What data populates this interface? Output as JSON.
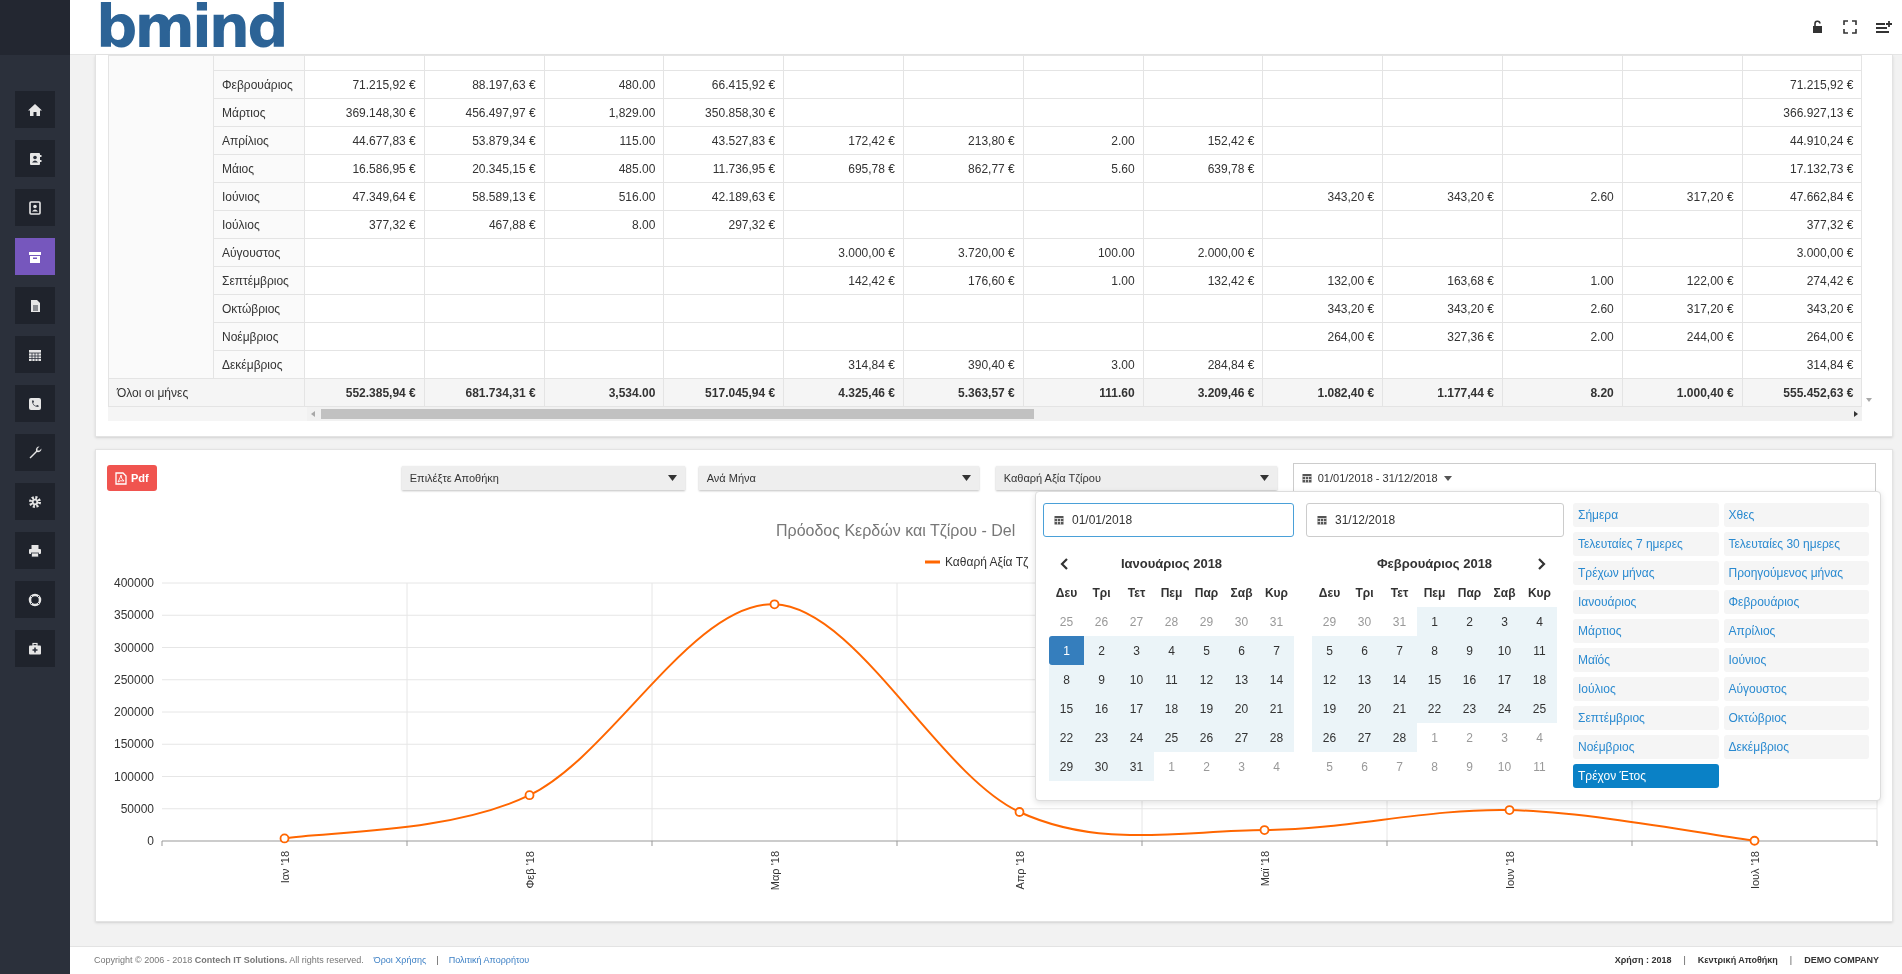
{
  "header": {
    "logo": "bmind"
  },
  "sidebar": {
    "items": [
      {
        "selected": false
      },
      {
        "selected": false
      },
      {
        "selected": false
      },
      {
        "selected": true
      },
      {
        "selected": false
      },
      {
        "selected": false
      },
      {
        "selected": false
      },
      {
        "selected": false
      },
      {
        "selected": false
      },
      {
        "selected": false
      },
      {
        "selected": false
      },
      {
        "selected": false
      }
    ]
  },
  "table": {
    "rows": [
      {
        "month": "Φεβρουάριος",
        "cells": [
          {
            "kind": "value",
            "text": "71.215,92 €"
          },
          {
            "kind": "value",
            "text": "88.197,63 €"
          },
          {
            "kind": "value",
            "text": "480.00"
          },
          {
            "kind": "value",
            "text": "66.415,92 €"
          },
          {
            "kind": "empty"
          },
          {
            "kind": "empty"
          },
          {
            "kind": "empty"
          },
          {
            "kind": "empty"
          },
          {
            "kind": "empty"
          },
          {
            "kind": "empty"
          },
          {
            "kind": "empty"
          },
          {
            "kind": "empty"
          },
          {
            "kind": "value",
            "text": "71.215,92 €"
          }
        ]
      },
      {
        "month": "Μάρτιος",
        "cells": [
          {
            "kind": "value",
            "text": "369.148,30 €"
          },
          {
            "kind": "value",
            "text": "456.497,97 €"
          },
          {
            "kind": "value",
            "text": "1,829.00"
          },
          {
            "kind": "value",
            "text": "350.858,30 €"
          },
          {
            "kind": "empty"
          },
          {
            "kind": "empty"
          },
          {
            "kind": "empty"
          },
          {
            "kind": "empty"
          },
          {
            "kind": "empty"
          },
          {
            "kind": "empty"
          },
          {
            "kind": "empty"
          },
          {
            "kind": "empty"
          },
          {
            "kind": "value",
            "text": "366.927,13 €"
          }
        ]
      },
      {
        "month": "Απρίλιος",
        "cells": [
          {
            "kind": "value",
            "text": "44.677,83 €"
          },
          {
            "kind": "value",
            "text": "53.879,34 €"
          },
          {
            "kind": "value",
            "text": "115.00"
          },
          {
            "kind": "value",
            "text": "43.527,83 €"
          },
          {
            "kind": "value",
            "text": "172,42 €"
          },
          {
            "kind": "value",
            "text": "213,80 €"
          },
          {
            "kind": "value",
            "text": "2.00"
          },
          {
            "kind": "value",
            "text": "152,42 €"
          },
          {
            "kind": "empty"
          },
          {
            "kind": "empty"
          },
          {
            "kind": "empty"
          },
          {
            "kind": "empty"
          },
          {
            "kind": "value",
            "text": "44.910,24 €"
          }
        ]
      },
      {
        "month": "Μάιος",
        "cells": [
          {
            "kind": "value",
            "text": "16.586,95 €"
          },
          {
            "kind": "value",
            "text": "20.345,15 €"
          },
          {
            "kind": "value",
            "text": "485.00"
          },
          {
            "kind": "value",
            "text": "11.736,95 €"
          },
          {
            "kind": "value",
            "text": "695,78 €"
          },
          {
            "kind": "value",
            "text": "862,77 €"
          },
          {
            "kind": "value",
            "text": "5.60"
          },
          {
            "kind": "value",
            "text": "639,78 €"
          },
          {
            "kind": "empty"
          },
          {
            "kind": "empty"
          },
          {
            "kind": "empty"
          },
          {
            "kind": "empty"
          },
          {
            "kind": "value",
            "text": "17.132,73 €"
          }
        ]
      },
      {
        "month": "Ιούνιος",
        "cells": [
          {
            "kind": "value",
            "text": "47.349,64 €"
          },
          {
            "kind": "value",
            "text": "58.589,13 €"
          },
          {
            "kind": "value",
            "text": "516.00"
          },
          {
            "kind": "value",
            "text": "42.189,63 €"
          },
          {
            "kind": "empty"
          },
          {
            "kind": "empty"
          },
          {
            "kind": "empty"
          },
          {
            "kind": "empty"
          },
          {
            "kind": "value",
            "text": "343,20 €"
          },
          {
            "kind": "value",
            "text": "343,20 €"
          },
          {
            "kind": "value",
            "text": "2.60"
          },
          {
            "kind": "value",
            "text": "317,20 €"
          },
          {
            "kind": "value",
            "text": "47.662,84 €"
          }
        ]
      },
      {
        "month": "Ιούλιος",
        "cells": [
          {
            "kind": "value",
            "text": "377,32 €"
          },
          {
            "kind": "value",
            "text": "467,88 €"
          },
          {
            "kind": "value",
            "text": "8.00"
          },
          {
            "kind": "value",
            "text": "297,32 €"
          },
          {
            "kind": "empty"
          },
          {
            "kind": "empty"
          },
          {
            "kind": "empty"
          },
          {
            "kind": "empty"
          },
          {
            "kind": "empty"
          },
          {
            "kind": "empty"
          },
          {
            "kind": "empty"
          },
          {
            "kind": "empty"
          },
          {
            "kind": "value",
            "text": "377,32 €"
          }
        ]
      },
      {
        "month": "Αύγουστος",
        "cells": [
          {
            "kind": "empty"
          },
          {
            "kind": "empty"
          },
          {
            "kind": "empty"
          },
          {
            "kind": "empty"
          },
          {
            "kind": "value",
            "text": "3.000,00 €"
          },
          {
            "kind": "value",
            "text": "3.720,00 €"
          },
          {
            "kind": "value",
            "text": "100.00"
          },
          {
            "kind": "value",
            "text": "2.000,00 €"
          },
          {
            "kind": "empty"
          },
          {
            "kind": "empty"
          },
          {
            "kind": "empty"
          },
          {
            "kind": "empty"
          },
          {
            "kind": "value",
            "text": "3.000,00 €"
          }
        ]
      },
      {
        "month": "Σεπτέμβριος",
        "cells": [
          {
            "kind": "empty"
          },
          {
            "kind": "empty"
          },
          {
            "kind": "empty"
          },
          {
            "kind": "empty"
          },
          {
            "kind": "value",
            "text": "142,42 €"
          },
          {
            "kind": "value",
            "text": "176,60 €"
          },
          {
            "kind": "value",
            "text": "1.00"
          },
          {
            "kind": "value",
            "text": "132,42 €"
          },
          {
            "kind": "value",
            "text": "132,00 €"
          },
          {
            "kind": "value",
            "text": "163,68 €"
          },
          {
            "kind": "value",
            "text": "1.00"
          },
          {
            "kind": "value",
            "text": "122,00 €"
          },
          {
            "kind": "value",
            "text": "274,42 €"
          }
        ]
      },
      {
        "month": "Οκτώβριος",
        "cells": [
          {
            "kind": "empty"
          },
          {
            "kind": "empty"
          },
          {
            "kind": "empty"
          },
          {
            "kind": "empty"
          },
          {
            "kind": "empty"
          },
          {
            "kind": "empty"
          },
          {
            "kind": "empty"
          },
          {
            "kind": "empty"
          },
          {
            "kind": "value",
            "text": "343,20 €"
          },
          {
            "kind": "value",
            "text": "343,20 €"
          },
          {
            "kind": "value",
            "text": "2.60"
          },
          {
            "kind": "value",
            "text": "317,20 €"
          },
          {
            "kind": "value",
            "text": "343,20 €"
          }
        ]
      },
      {
        "month": "Νοέμβριος",
        "cells": [
          {
            "kind": "empty"
          },
          {
            "kind": "empty"
          },
          {
            "kind": "empty"
          },
          {
            "kind": "empty"
          },
          {
            "kind": "empty"
          },
          {
            "kind": "empty"
          },
          {
            "kind": "empty"
          },
          {
            "kind": "empty"
          },
          {
            "kind": "value",
            "text": "264,00 €"
          },
          {
            "kind": "value",
            "text": "327,36 €"
          },
          {
            "kind": "value",
            "text": "2.00"
          },
          {
            "kind": "value",
            "text": "244,00 €"
          },
          {
            "kind": "value",
            "text": "264,00 €"
          }
        ]
      },
      {
        "month": "Δεκέμβριος",
        "cells": [
          {
            "kind": "empty"
          },
          {
            "kind": "empty"
          },
          {
            "kind": "empty"
          },
          {
            "kind": "empty"
          },
          {
            "kind": "value",
            "text": "314,84 €"
          },
          {
            "kind": "value",
            "text": "390,40 €"
          },
          {
            "kind": "value",
            "text": "3.00"
          },
          {
            "kind": "value",
            "text": "284,84 €"
          },
          {
            "kind": "empty"
          },
          {
            "kind": "empty"
          },
          {
            "kind": "empty"
          },
          {
            "kind": "empty"
          },
          {
            "kind": "value",
            "text": "314,84 €"
          }
        ]
      }
    ],
    "total": {
      "label": "Όλοι οι μήνες",
      "values": [
        "552.385,94 €",
        "681.734,31 €",
        "3,534.00",
        "517.045,94 €",
        "4.325,46 €",
        "5.363,57 €",
        "111.60",
        "3.209,46 €",
        "1.082,40 €",
        "1.177,44 €",
        "8.20",
        "1.000,40 €",
        "555.452,63 €"
      ]
    }
  },
  "chart_panel": {
    "pdf_button": "Pdf",
    "filters": [
      {
        "value": "Επιλέξτε Αποθήκη"
      },
      {
        "value": "Ανά Μήνα"
      },
      {
        "value": "Καθαρή Αξία Τζίρου"
      }
    ],
    "date_range": "01/01/2018 - 31/12/2018",
    "chart_data": {
      "type": "line",
      "title": "Πρόοδος Κερδών και Τζίρου - Del",
      "categories": [
        "Ιαν '18",
        "Φεβ '18",
        "Μαρ '18",
        "Απρ '18",
        "Μαϊ '18",
        "Ιουν '18",
        "Ιουλ '18"
      ],
      "series": [
        {
          "name": "Καθαρή Αξία Τζ",
          "color": "#ff6600",
          "marker": true,
          "values": [
            4000,
            71000,
            367000,
            45000,
            17000,
            48000,
            400
          ]
        }
      ],
      "ylim": [
        0,
        400000
      ],
      "yticks": [
        0,
        50000,
        100000,
        150000,
        200000,
        250000,
        300000,
        350000,
        400000
      ],
      "grid": true
    },
    "date_picker": {
      "start_input": "01/01/2018",
      "end_input": "31/12/2018",
      "calendars": [
        {
          "title": "Ιανουάριος 2018",
          "weekdays": [
            "Δευ",
            "Τρι",
            "Τετ",
            "Πεμ",
            "Παρ",
            "Σαβ",
            "Κυρ"
          ],
          "weeks": [
            [
              {
                "day": "25",
                "kind": "off"
              },
              {
                "day": "26",
                "kind": "off"
              },
              {
                "day": "27",
                "kind": "off"
              },
              {
                "day": "28",
                "kind": "off"
              },
              {
                "day": "29",
                "kind": "off"
              },
              {
                "day": "30",
                "kind": "off"
              },
              {
                "day": "31",
                "kind": "off"
              }
            ],
            [
              {
                "day": "1",
                "kind": "start"
              },
              {
                "day": "2",
                "kind": "in_range"
              },
              {
                "day": "3",
                "kind": "in_range"
              },
              {
                "day": "4",
                "kind": "in_range"
              },
              {
                "day": "5",
                "kind": "in_range"
              },
              {
                "day": "6",
                "kind": "in_range"
              },
              {
                "day": "7",
                "kind": "in_range"
              }
            ],
            [
              {
                "day": "8",
                "kind": "in_range"
              },
              {
                "day": "9",
                "kind": "in_range"
              },
              {
                "day": "10",
                "kind": "in_range"
              },
              {
                "day": "11",
                "kind": "in_range"
              },
              {
                "day": "12",
                "kind": "in_range"
              },
              {
                "day": "13",
                "kind": "in_range"
              },
              {
                "day": "14",
                "kind": "in_range"
              }
            ],
            [
              {
                "day": "15",
                "kind": "in_range"
              },
              {
                "day": "16",
                "kind": "in_range"
              },
              {
                "day": "17",
                "kind": "in_range"
              },
              {
                "day": "18",
                "kind": "in_range"
              },
              {
                "day": "19",
                "kind": "in_range"
              },
              {
                "day": "20",
                "kind": "in_range"
              },
              {
                "day": "21",
                "kind": "in_range"
              }
            ],
            [
              {
                "day": "22",
                "kind": "in_range"
              },
              {
                "day": "23",
                "kind": "in_range"
              },
              {
                "day": "24",
                "kind": "in_range"
              },
              {
                "day": "25",
                "kind": "in_range"
              },
              {
                "day": "26",
                "kind": "in_range"
              },
              {
                "day": "27",
                "kind": "in_range"
              },
              {
                "day": "28",
                "kind": "in_range"
              }
            ],
            [
              {
                "day": "29",
                "kind": "in_range"
              },
              {
                "day": "30",
                "kind": "in_range"
              },
              {
                "day": "31",
                "kind": "in_range"
              },
              {
                "day": "1",
                "kind": "off"
              },
              {
                "day": "2",
                "kind": "off"
              },
              {
                "day": "3",
                "kind": "off"
              },
              {
                "day": "4",
                "kind": "off"
              }
            ]
          ]
        },
        {
          "title": "Φεβρουάριος 2018",
          "weekdays": [
            "Δευ",
            "Τρι",
            "Τετ",
            "Πεμ",
            "Παρ",
            "Σαβ",
            "Κυρ"
          ],
          "weeks": [
            [
              {
                "day": "29",
                "kind": "off"
              },
              {
                "day": "30",
                "kind": "off"
              },
              {
                "day": "31",
                "kind": "off"
              },
              {
                "day": "1",
                "kind": "in_range"
              },
              {
                "day": "2",
                "kind": "in_range"
              },
              {
                "day": "3",
                "kind": "in_range"
              },
              {
                "day": "4",
                "kind": "in_range"
              }
            ],
            [
              {
                "day": "5",
                "kind": "in_range"
              },
              {
                "day": "6",
                "kind": "in_range"
              },
              {
                "day": "7",
                "kind": "in_range"
              },
              {
                "day": "8",
                "kind": "in_range"
              },
              {
                "day": "9",
                "kind": "in_range"
              },
              {
                "day": "10",
                "kind": "in_range"
              },
              {
                "day": "11",
                "kind": "in_range"
              }
            ],
            [
              {
                "day": "12",
                "kind": "in_range"
              },
              {
                "day": "13",
                "kind": "in_range"
              },
              {
                "day": "14",
                "kind": "in_range"
              },
              {
                "day": "15",
                "kind": "in_range"
              },
              {
                "day": "16",
                "kind": "in_range"
              },
              {
                "day": "17",
                "kind": "in_range"
              },
              {
                "day": "18",
                "kind": "in_range"
              }
            ],
            [
              {
                "day": "19",
                "kind": "in_range"
              },
              {
                "day": "20",
                "kind": "in_range"
              },
              {
                "day": "21",
                "kind": "in_range"
              },
              {
                "day": "22",
                "kind": "in_range"
              },
              {
                "day": "23",
                "kind": "in_range"
              },
              {
                "day": "24",
                "kind": "in_range"
              },
              {
                "day": "25",
                "kind": "in_range"
              }
            ],
            [
              {
                "day": "26",
                "kind": "in_range"
              },
              {
                "day": "27",
                "kind": "in_range"
              },
              {
                "day": "28",
                "kind": "in_range"
              },
              {
                "day": "1",
                "kind": "off"
              },
              {
                "day": "2",
                "kind": "off"
              },
              {
                "day": "3",
                "kind": "off"
              },
              {
                "day": "4",
                "kind": "off"
              }
            ],
            [
              {
                "day": "5",
                "kind": "off"
              },
              {
                "day": "6",
                "kind": "off"
              },
              {
                "day": "7",
                "kind": "off"
              },
              {
                "day": "8",
                "kind": "off"
              },
              {
                "day": "9",
                "kind": "off"
              },
              {
                "day": "10",
                "kind": "off"
              },
              {
                "day": "11",
                "kind": "off"
              }
            ]
          ]
        }
      ],
      "ranges": [
        {
          "label": "Σήμερα",
          "selected": false
        },
        {
          "label": "Χθες",
          "selected": false
        },
        {
          "label": "Τελευταίες 7 ημερες",
          "selected": false
        },
        {
          "label": "Τελευταίες 30 ημερες",
          "selected": false
        },
        {
          "label": "Τρέχων μήνας",
          "selected": false
        },
        {
          "label": "Προηγούμενος μήνας",
          "selected": false
        },
        {
          "label": "Ιανουάριος",
          "selected": false
        },
        {
          "label": "Φεβρουάριος",
          "selected": false
        },
        {
          "label": "Μάρτιος",
          "selected": false
        },
        {
          "label": "Απρίλιος",
          "selected": false
        },
        {
          "label": "Μαϊός",
          "selected": false
        },
        {
          "label": "Ιούνιος",
          "selected": false
        },
        {
          "label": "Ιούλιος",
          "selected": false
        },
        {
          "label": "Αύγουστος",
          "selected": false
        },
        {
          "label": "Σεπτέμβριος",
          "selected": false
        },
        {
          "label": "Οκτώβριος",
          "selected": false
        },
        {
          "label": "Νοέμβριος",
          "selected": false
        },
        {
          "label": "Δεκέμβριος",
          "selected": false
        },
        {
          "label": "Τρέχον Έτος",
          "selected": true
        }
      ]
    }
  },
  "footer": {
    "left": [
      {
        "kind": "copyright",
        "text": "Copyright © 2006 - 2018 **Contech IT Solutions.** All rights reserved."
      },
      {
        "kind": "link",
        "text": "Όροι Χρήσης"
      },
      {
        "kind": "separator",
        "text": "|"
      },
      {
        "kind": "link",
        "text": "Πολιτική Απορρήτου"
      }
    ],
    "right": [
      {
        "kind": "info",
        "text": "Χρήση : 2018"
      },
      {
        "kind": "separator",
        "text": "|"
      },
      {
        "kind": "info",
        "text": "Κεντρική Αποθήκη"
      },
      {
        "kind": "separator",
        "text": "|"
      },
      {
        "kind": "info",
        "text": "DEMO COMPANY"
      }
    ]
  }
}
